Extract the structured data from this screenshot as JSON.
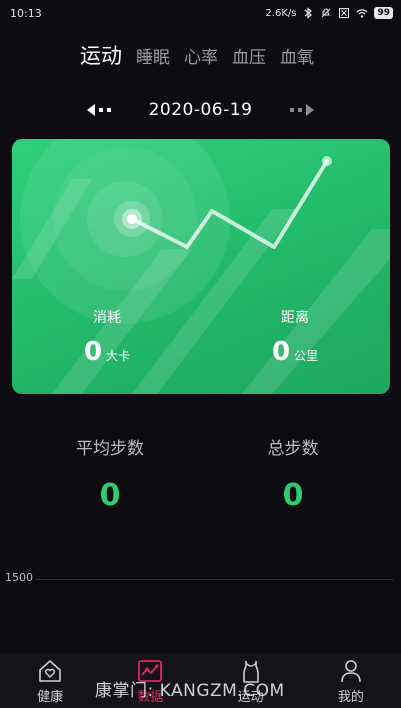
{
  "status_bar": {
    "time": "10:13",
    "network_speed": "2.6K/s",
    "battery": "99"
  },
  "tabs": [
    {
      "label": "运动",
      "active": true
    },
    {
      "label": "睡眠",
      "active": false
    },
    {
      "label": "心率",
      "active": false
    },
    {
      "label": "血压",
      "active": false
    },
    {
      "label": "血氧",
      "active": false
    }
  ],
  "date_nav": {
    "date": "2020-06-19",
    "prev_icon": "arrow-left-icon",
    "next_icon": "arrow-right-icon"
  },
  "card": {
    "accent_color": "#2ed17d",
    "calories": {
      "label": "消耗",
      "value": "0",
      "unit": "大卡"
    },
    "distance": {
      "label": "距离",
      "value": "0",
      "unit": "公里"
    }
  },
  "summary": {
    "avg_steps": {
      "label": "平均步数",
      "value": "0"
    },
    "total_steps": {
      "label": "总步数",
      "value": "0"
    },
    "value_color": "#2ecc71"
  },
  "chart": {
    "y_tick": "1500"
  },
  "bottom_nav": [
    {
      "label": "健康",
      "icon": "heart-house-icon",
      "active": false
    },
    {
      "label": "数据",
      "icon": "data-chart-icon",
      "active": true
    },
    {
      "label": "运动",
      "icon": "shirt-icon",
      "active": false
    },
    {
      "label": "我的",
      "icon": "person-icon",
      "active": false
    }
  ],
  "watermark": "康掌门: KANGZM.COM"
}
